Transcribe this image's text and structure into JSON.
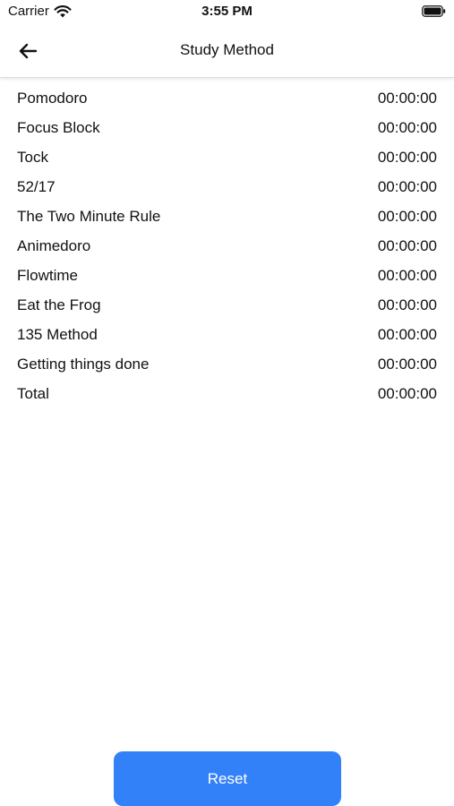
{
  "status_bar": {
    "carrier": "Carrier",
    "time": "3:55 PM"
  },
  "header": {
    "title": "Study Method",
    "back_icon": "arrow-left-icon"
  },
  "methods": [
    {
      "name": "Pomodoro",
      "time": "00:00:00"
    },
    {
      "name": "Focus Block",
      "time": "00:00:00"
    },
    {
      "name": "Tock",
      "time": "00:00:00"
    },
    {
      "name": "52/17",
      "time": "00:00:00"
    },
    {
      "name": "The Two Minute Rule",
      "time": "00:00:00"
    },
    {
      "name": "Animedoro",
      "time": "00:00:00"
    },
    {
      "name": "Flowtime",
      "time": "00:00:00"
    },
    {
      "name": "Eat the Frog",
      "time": "00:00:00"
    },
    {
      "name": "135 Method",
      "time": "00:00:00"
    },
    {
      "name": "Getting things done",
      "time": "00:00:00"
    },
    {
      "name": "Total",
      "time": "00:00:00"
    }
  ],
  "reset_button": {
    "label": "Reset",
    "color": "#3381f8"
  }
}
